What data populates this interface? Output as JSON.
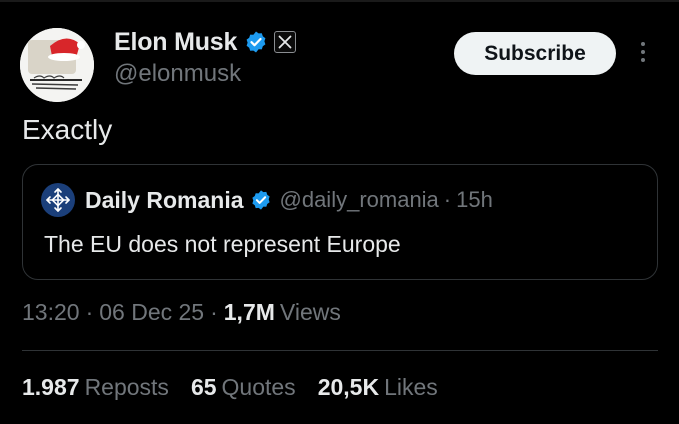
{
  "tweet": {
    "author": {
      "name": "Elon Musk",
      "handle": "@elonmusk",
      "verified_color": "#1d9bf0",
      "affiliation_badge": "X"
    },
    "subscribe_label": "Subscribe",
    "text": "Exactly",
    "quote": {
      "name": "Daily Romania",
      "handle": "@daily_romania",
      "separator": "·",
      "time": "15h",
      "text": "The EU does not represent Europe"
    },
    "meta": {
      "time": "13:20",
      "separator": "·",
      "date": "06 Dec 25",
      "views_count": "1,7M",
      "views_label": "Views"
    },
    "stats": {
      "reposts_count": "1.987",
      "reposts_label": "Reposts",
      "quotes_count": "65",
      "quotes_label": "Quotes",
      "likes_count": "20,5K",
      "likes_label": "Likes"
    }
  },
  "colors": {
    "background": "#000000",
    "text_primary": "#e7e9ea",
    "text_secondary": "#71767b",
    "border": "#2f3336",
    "verified": "#1d9bf0",
    "button_bg": "#eff3f4"
  }
}
